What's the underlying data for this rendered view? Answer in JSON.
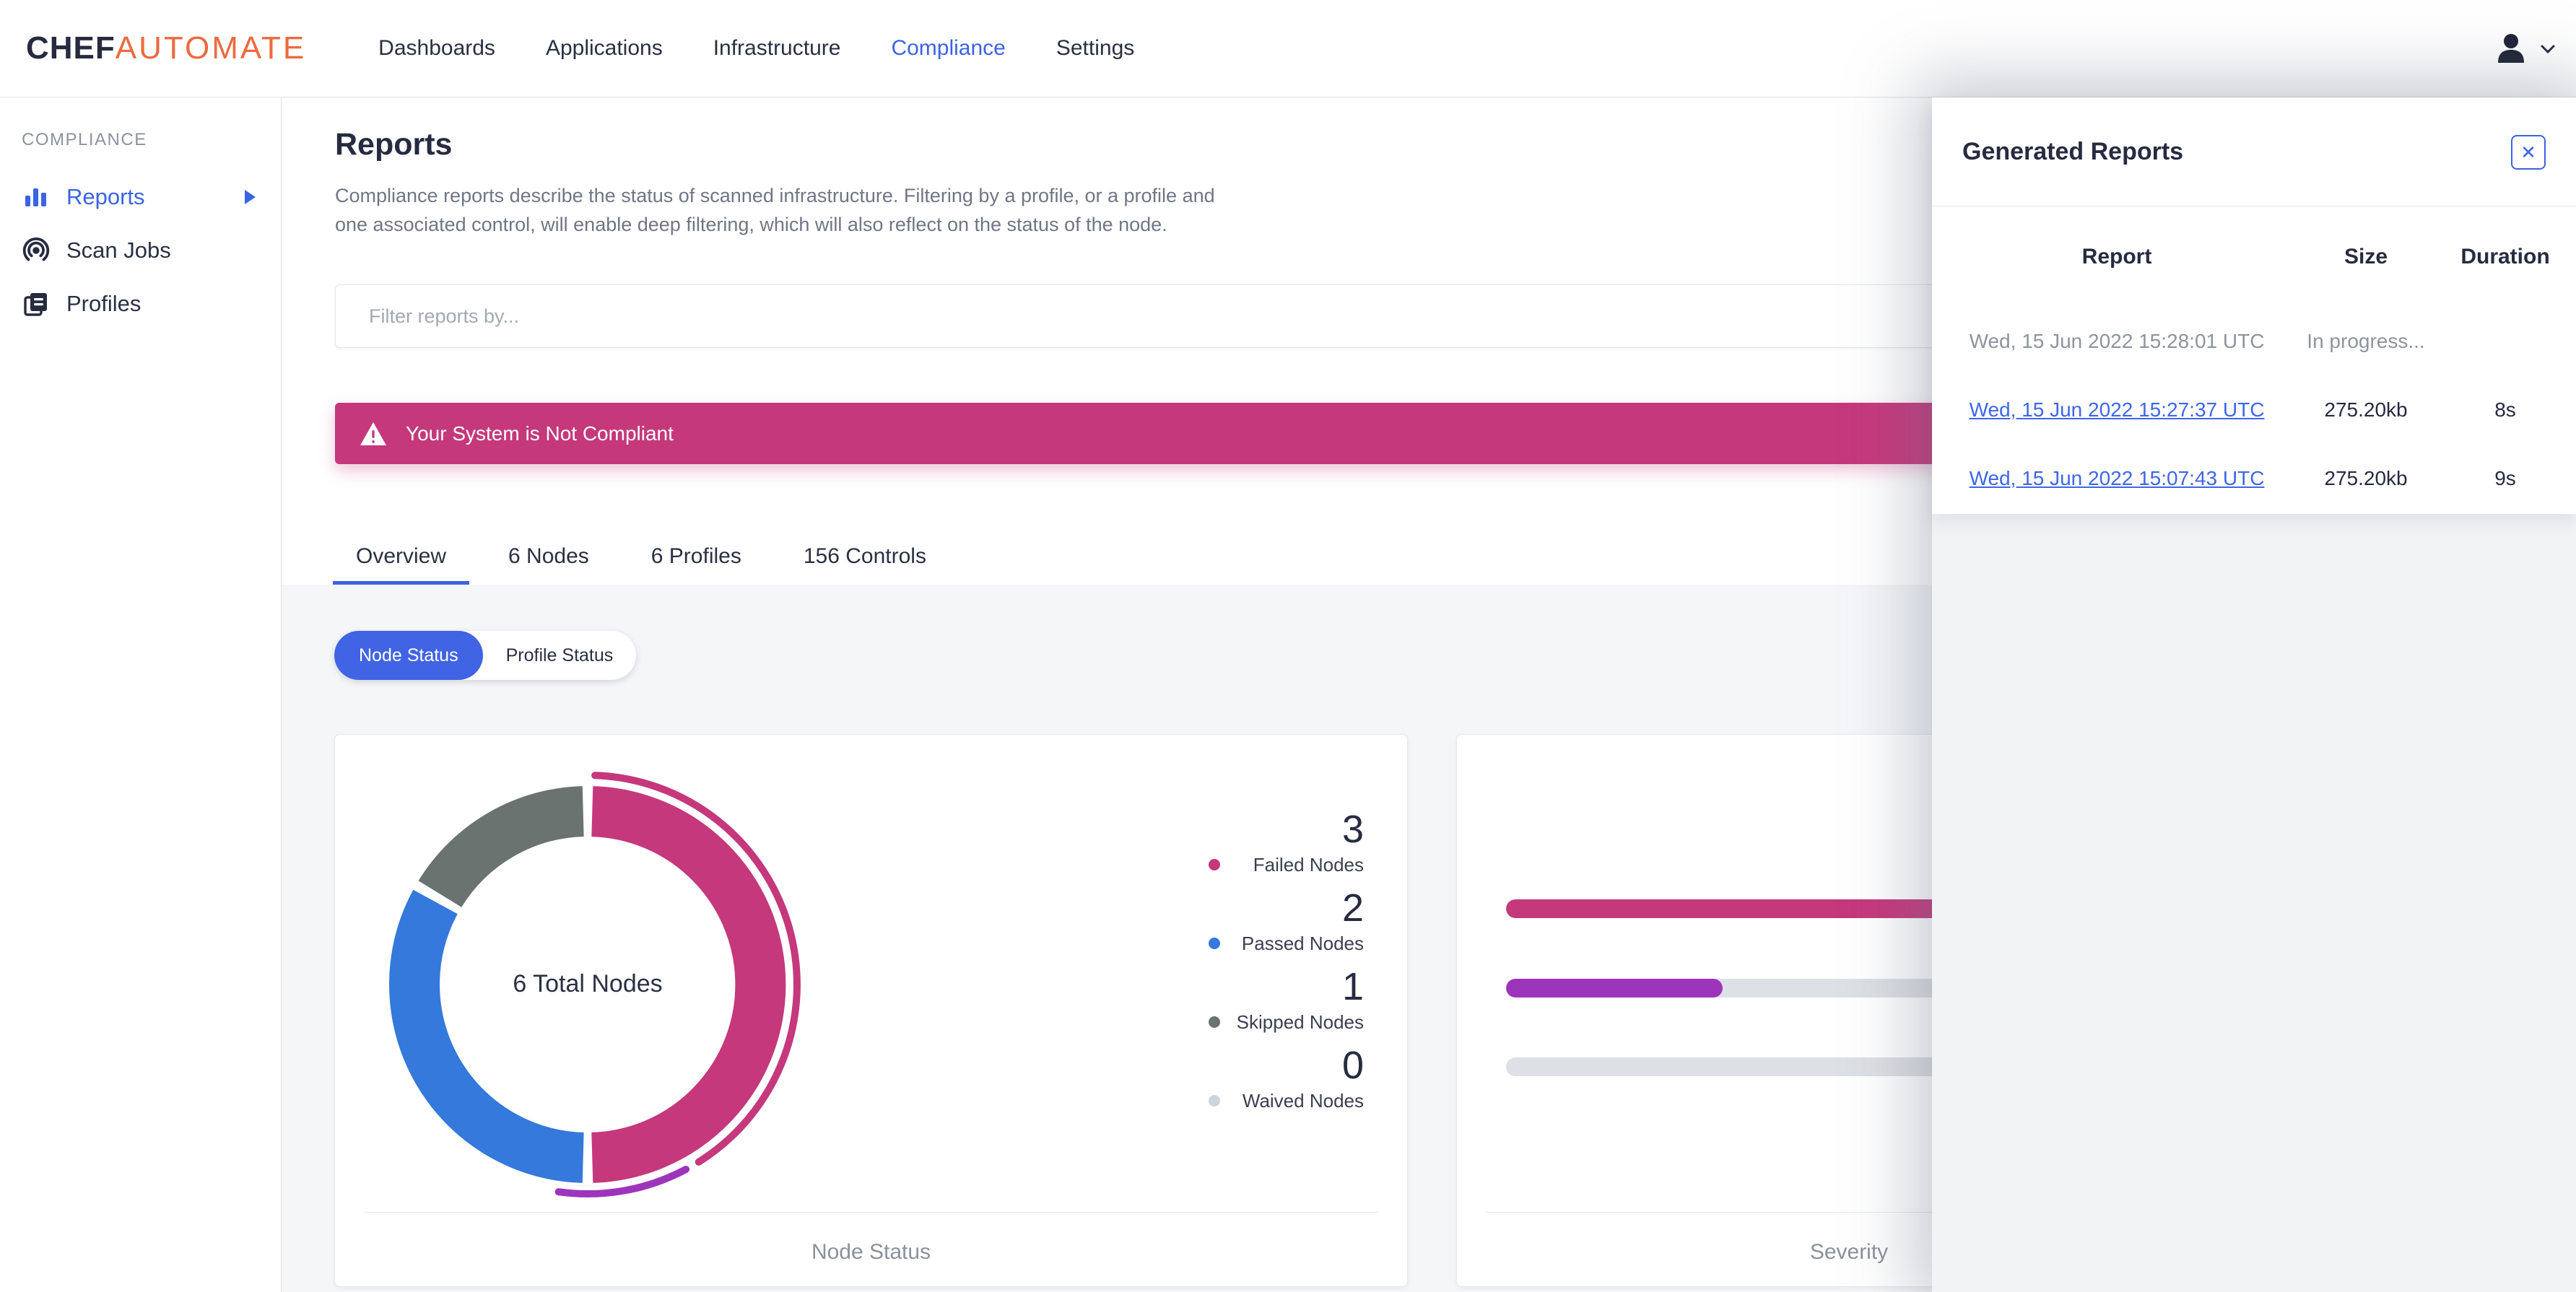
{
  "nav": {
    "logo": {
      "chef": "CHEF",
      "automate": "AUTOMATE"
    },
    "items": [
      {
        "label": "Dashboards",
        "active": false
      },
      {
        "label": "Applications",
        "active": false
      },
      {
        "label": "Infrastructure",
        "active": false
      },
      {
        "label": "Compliance",
        "active": true
      },
      {
        "label": "Settings",
        "active": false
      }
    ]
  },
  "sidebar": {
    "section": "COMPLIANCE",
    "items": [
      {
        "label": "Reports",
        "icon": "bar-chart-icon",
        "active": true,
        "has_submenu": true
      },
      {
        "label": "Scan Jobs",
        "icon": "radar-icon",
        "active": false,
        "has_submenu": false
      },
      {
        "label": "Profiles",
        "icon": "profiles-icon",
        "active": false,
        "has_submenu": false
      }
    ]
  },
  "page": {
    "title": "Reports",
    "description": "Compliance reports describe the status of scanned infrastructure. Filtering by a profile, or a profile and\none associated control, will enable deep filtering, which will also reflect on the status of the node.",
    "filter_placeholder": "Filter reports by...",
    "banner_text": "Your System is Not Compliant",
    "tabs": [
      {
        "label": "Overview",
        "active": true
      },
      {
        "label": "6 Nodes",
        "active": false
      },
      {
        "label": "6 Profiles",
        "active": false
      },
      {
        "label": "156 Controls",
        "active": false
      }
    ],
    "status_toggle": [
      {
        "label": "Node Status",
        "active": true
      },
      {
        "label": "Profile Status",
        "active": false
      }
    ]
  },
  "node_status_card": {
    "center_label": "6 Total Nodes",
    "footer": "Node Status",
    "legend": [
      {
        "value": 3,
        "label": "Failed Nodes",
        "color": "#C5387C"
      },
      {
        "value": 2,
        "label": "Passed Nodes",
        "color": "#3479DB"
      },
      {
        "value": 1,
        "label": "Skipped Nodes",
        "color": "#6B7370"
      },
      {
        "value": 0,
        "label": "Waived Nodes",
        "color": "#CDD5DC"
      }
    ]
  },
  "severity_card": {
    "footer": "Severity"
  },
  "generated_reports": {
    "title": "Generated Reports",
    "close_icon": "✕",
    "columns": [
      "Report",
      "Size",
      "Duration"
    ],
    "rows": [
      {
        "report": "Wed, 15 Jun 2022 15:28:01 UTC",
        "size": "In progress...",
        "duration": "",
        "is_link": false
      },
      {
        "report": "Wed, 15 Jun 2022 15:27:37 UTC",
        "size": "275.20kb",
        "duration": "8s",
        "is_link": true
      },
      {
        "report": "Wed, 15 Jun 2022 15:07:43 UTC",
        "size": "275.20kb",
        "duration": "9s",
        "is_link": true
      }
    ]
  },
  "colors": {
    "accent_blue": "#3B63E4",
    "toggle_blue": "#4064E3",
    "banner_pink": "#C5387C",
    "passed_blue": "#3479DB",
    "skipped_gray": "#6B7370",
    "waived_gray": "#CDD5DC",
    "purple": "#9D35BB",
    "logo_orange": "#ED6A3F",
    "dark_navy": "#262B40",
    "page_bg": "#F4F6F8",
    "drawer_bg": "#F1F3F5"
  },
  "chart_data": [
    {
      "type": "pie",
      "subtype": "donut",
      "title": "Node Status",
      "center_label": "6 Total Nodes",
      "total": 6,
      "values": [
        {
          "label": "Failed Nodes",
          "value": 3,
          "color": "#C5387C"
        },
        {
          "label": "Passed Nodes",
          "value": 2,
          "color": "#3479DB"
        },
        {
          "label": "Skipped Nodes",
          "value": 1,
          "color": "#6B7370"
        },
        {
          "label": "Waived Nodes",
          "value": 0,
          "color": "#CDD5DC"
        }
      ],
      "outer_arcs": [
        {
          "from": 2,
          "to": 148,
          "color": "#C5387C"
        },
        {
          "from": 152,
          "to": 188,
          "color": "#9D35BB"
        }
      ],
      "legend_position": "right"
    },
    {
      "type": "bar",
      "orientation": "horizontal",
      "title": "Severity",
      "values": [
        {
          "fill_pct": 100,
          "color": "#C5387C"
        },
        {
          "fill_pct": 31.5,
          "color": "#9D35BB"
        },
        {
          "fill_pct": 0,
          "color": null
        }
      ],
      "track_color": "#DDE0E4"
    }
  ]
}
